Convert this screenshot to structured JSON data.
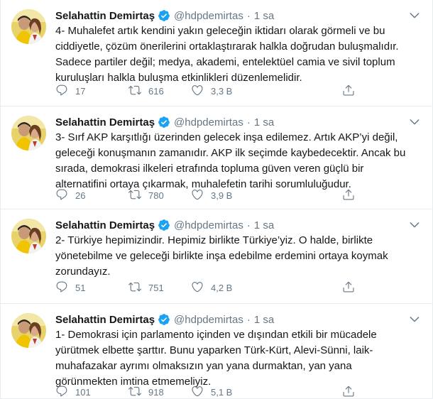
{
  "tweets": [
    {
      "name": "Selahattin Demirtaş",
      "handle": "@hdpdemirtas",
      "separator": "·",
      "time": "1 sa",
      "text": "4- Muhalefet artık kendini yakın geleceğin iktidarı olarak görmeli ve bu\nciddiyetle, çözüm önerilerini ortaklaştırarak halkla doğrudan buluşmalıdır.\nSadece partiler değil; medya, akademi, entelektüel camia ve sivil toplum\nkuruluşları halkla buluşma etkinlikleri düzenlemelidir.",
      "replies": "17",
      "retweets": "616",
      "likes": "3,3 B"
    },
    {
      "name": "Selahattin Demirtaş",
      "handle": "@hdpdemirtas",
      "separator": "·",
      "time": "1 sa",
      "text": "3- Sırf AKP karşıtlığı üzerinden gelecek inşa edilemez. Artık AKP’yi değil,\ngeleceği konuşmanın zamanıdır. AKP ilk seçimde kaybedecektir. Ancak bu\nsırada, demokrasi ilkeleri etrafında topluma güven veren güçlü bir\nalternatifini ortaya çıkarmak, muhalefetin tarihi sorumluluğudur.",
      "replies": "26",
      "retweets": "780",
      "likes": "3,9 B"
    },
    {
      "name": "Selahattin Demirtaş",
      "handle": "@hdpdemirtas",
      "separator": "·",
      "time": "1 sa",
      "text": "2- Türkiye hepimizindir. Hepimiz birlikte Türkiye’yiz. O halde, birlikte\nyönetebilme ve geleceği birlikte inşa edebilme erdemini ortaya koymak\nzorundayız.",
      "replies": "51",
      "retweets": "751",
      "likes": "4,2 B"
    },
    {
      "name": "Selahattin Demirtaş",
      "handle": "@hdpdemirtas",
      "separator": "·",
      "time": "1 sa",
      "text": "1- Demokrasi için parlamento içinden ve dışından etkili bir mücadele\nyürütmek elbette şarttır. Bunu yaparken Türk-Kürt, Alevi-Sünni, laik-\nmuhafazakar ayrımı olmaksızın yan yana durmaktan, yan yana\ngörünmekten imtina etmemeliyiz.",
      "replies": "101",
      "retweets": "918",
      "likes": "5,1 B"
    }
  ],
  "icons": {
    "verified": "verified-badge-icon",
    "caret": "chevron-down-icon",
    "reply": "reply-icon",
    "retweet": "retweet-icon",
    "like": "heart-icon",
    "share": "share-icon"
  },
  "colors": {
    "text": "#14171a",
    "secondary": "#657786",
    "verified": "#1da1f2",
    "border": "#e6ecf0"
  }
}
